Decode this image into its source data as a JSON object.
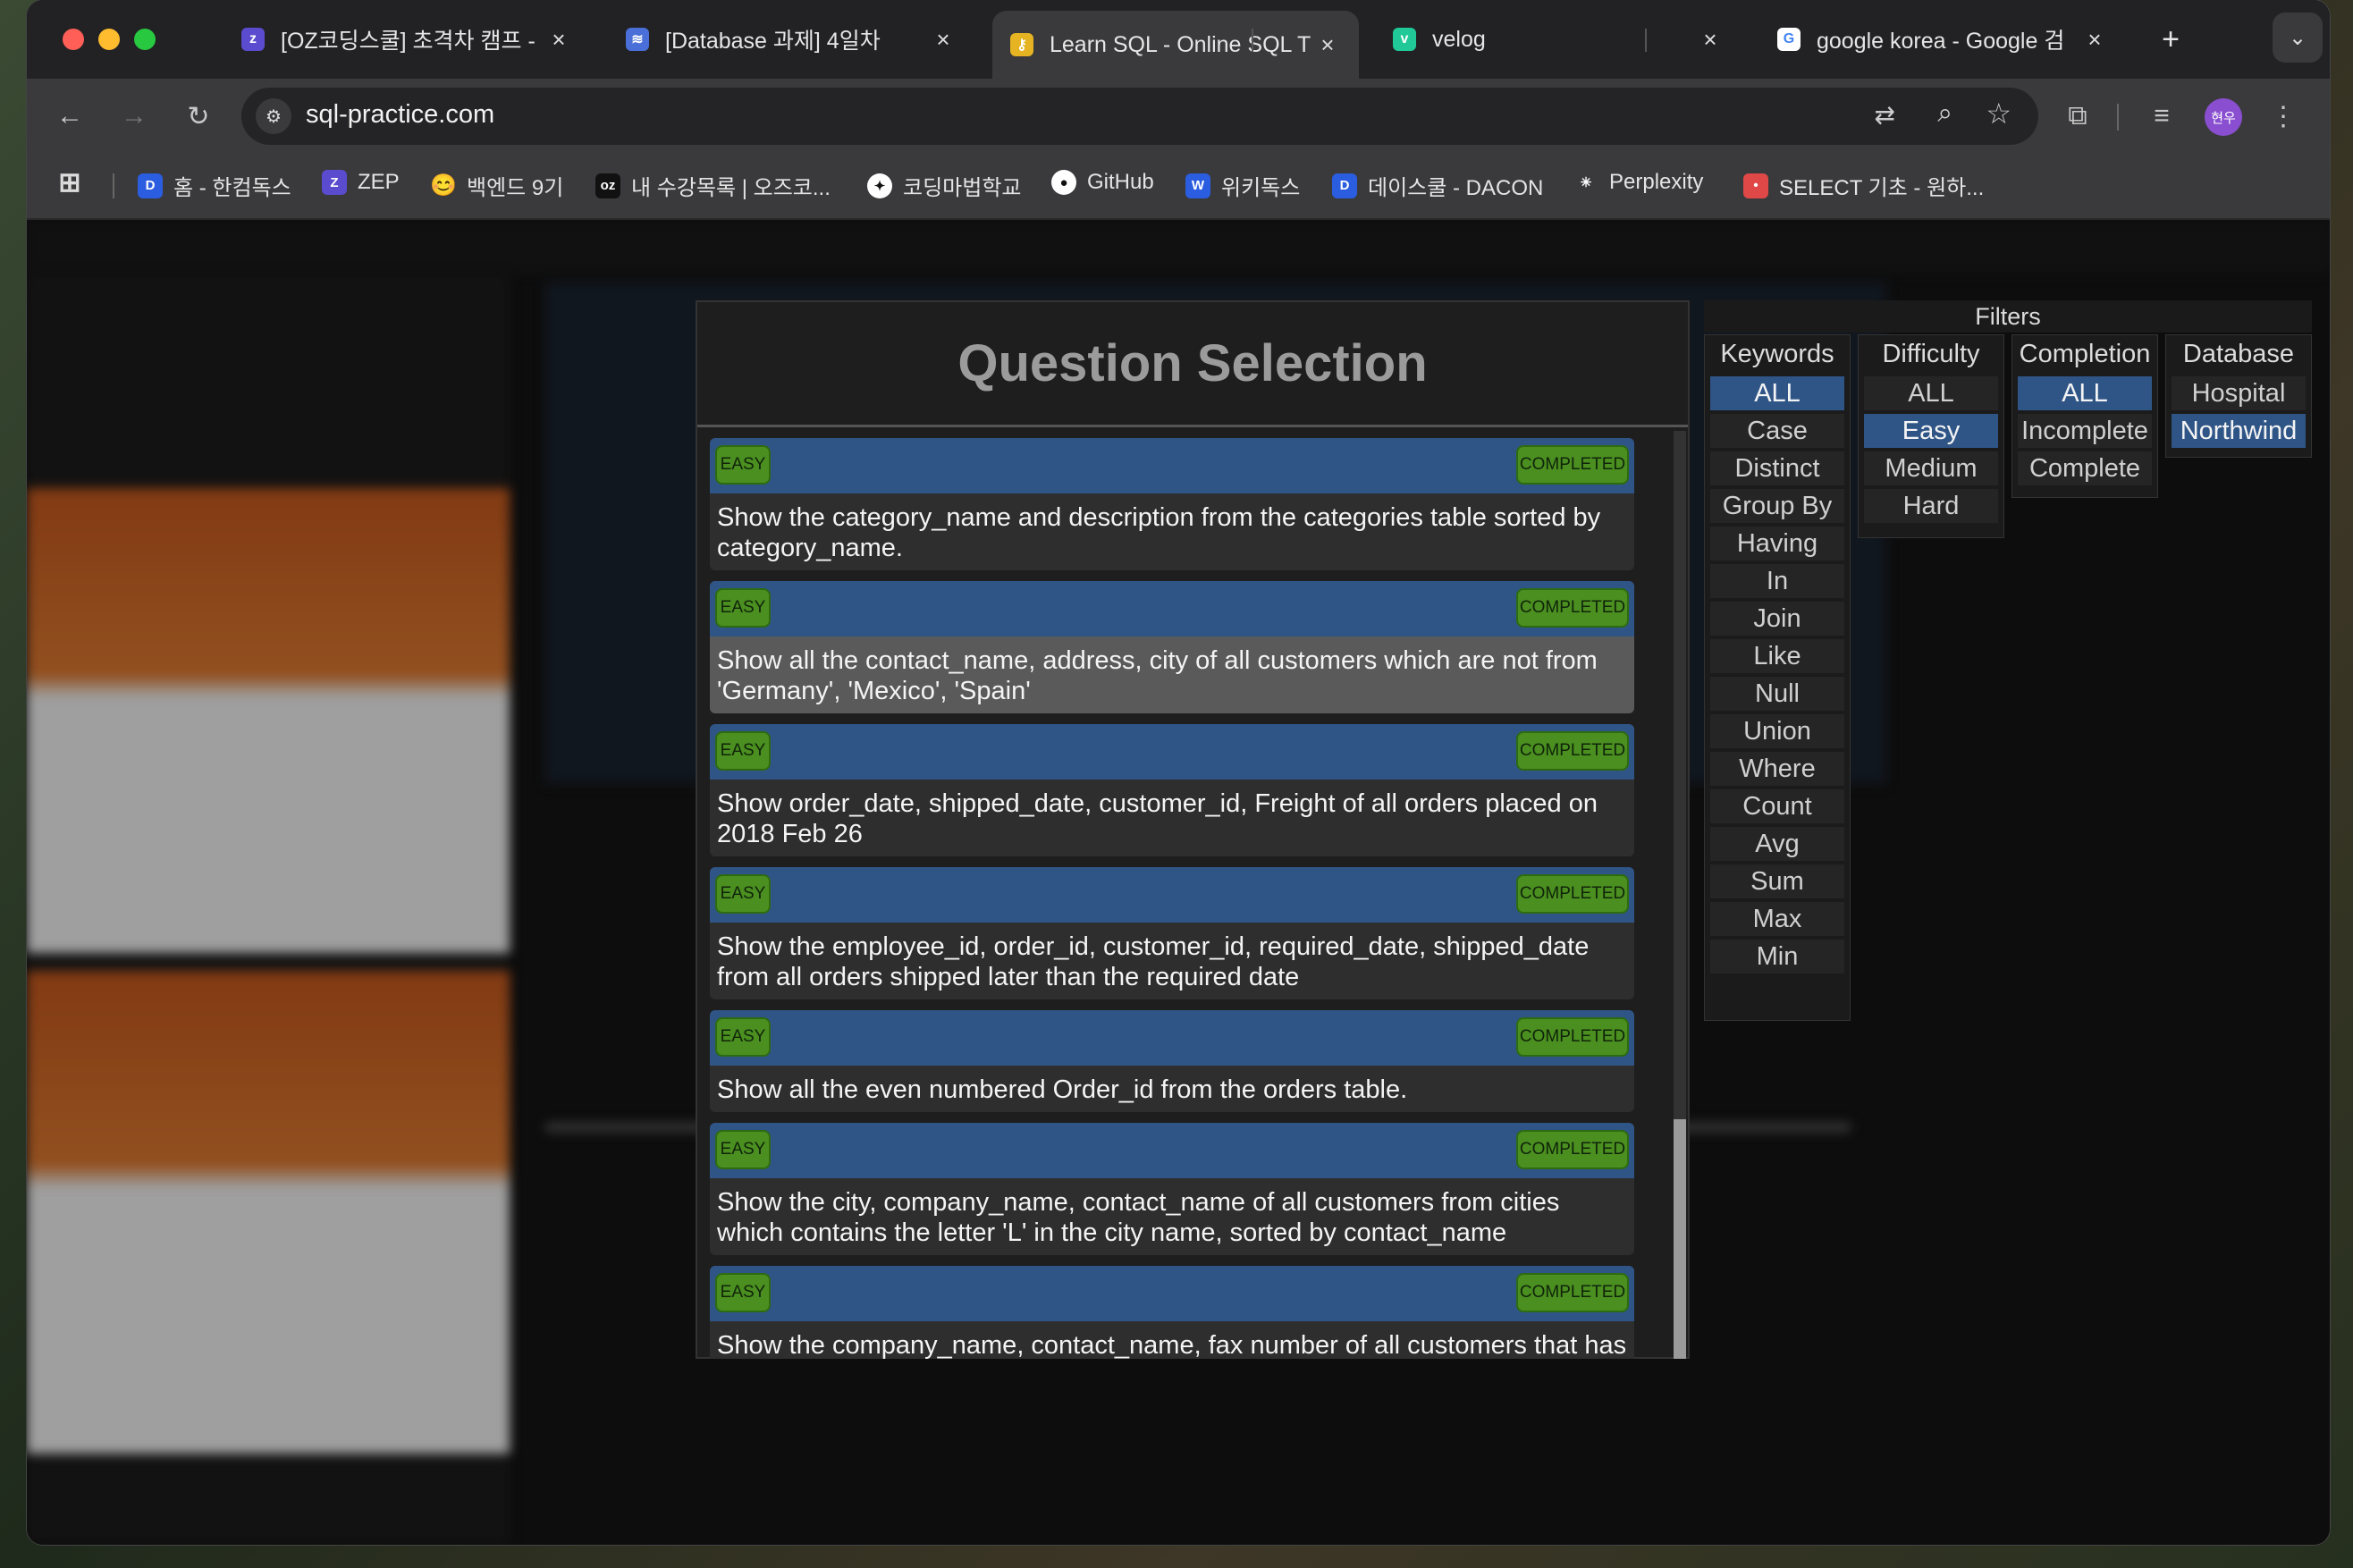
{
  "browser": {
    "tabs": [
      {
        "title": "[OZ코딩스쿨] 초격차 캠프 - ",
        "icon": "oz-logo-icon",
        "icon_color": "#5b4ccf",
        "active": false
      },
      {
        "title": "[Database 과제] 4일차",
        "icon": "database-icon",
        "icon_color": "#4a6fd8",
        "active": false
      },
      {
        "title": "Learn SQL - Online SQL T",
        "icon": "key-icon",
        "icon_color": "#e6b422",
        "active": true
      },
      {
        "title": "velog",
        "icon": "velog-icon",
        "icon_color": "#20c997",
        "active": false
      },
      {
        "title": "google korea - Google 검",
        "icon": "google-icon",
        "icon_color": "#ffffff",
        "active": false
      }
    ],
    "new_tab": "+",
    "url": "sql-practice.com",
    "profile": "현우",
    "bookmarks": [
      {
        "label": "",
        "icon": "apps-grid-icon"
      },
      {
        "label": "홈 - 한컴독스",
        "icon": "hancom-docs-icon",
        "icon_color": "#2b5de0",
        "glyph": "D"
      },
      {
        "label": "ZEP",
        "icon": "zep-icon",
        "icon_color": "#5b4ccf",
        "glyph": "Z"
      },
      {
        "label": "백엔드 9기",
        "icon": "smile-emoji-icon",
        "glyph": "😊"
      },
      {
        "label": "내 수강목록 | 오즈코...",
        "icon": "oz-icon",
        "icon_color": "#111111",
        "glyph": "oz"
      },
      {
        "label": "코딩마법학교",
        "icon": "wand-icon",
        "icon_color": "#ffffff",
        "glyph": "✦"
      },
      {
        "label": "GitHub",
        "icon": "github-icon",
        "icon_color": "#ffffff",
        "glyph": "●"
      },
      {
        "label": "위키독스",
        "icon": "wikidocs-icon",
        "icon_color": "#2b5de0",
        "glyph": "W"
      },
      {
        "label": "데이스쿨 - DACON",
        "icon": "dacon-icon",
        "icon_color": "#2b5de0",
        "glyph": "D"
      },
      {
        "label": "Perplexity",
        "icon": "perplexity-icon",
        "icon_color": "#3a3a3c",
        "glyph": "✳"
      },
      {
        "label": "SELECT 기초 - 원하...",
        "icon": "select-basics-icon",
        "icon_color": "#e04848",
        "glyph": "•"
      }
    ]
  },
  "modal": {
    "title": "Question Selection",
    "questions": [
      {
        "difficulty": "EASY",
        "status": "COMPLETED",
        "text": "Show the category_name and description from the categories table sorted by category_name."
      },
      {
        "difficulty": "EASY",
        "status": "COMPLETED",
        "text": "Show all the contact_name, address, city of all customers which are not from 'Germany', 'Mexico', 'Spain'"
      },
      {
        "difficulty": "EASY",
        "status": "COMPLETED",
        "text": "Show order_date, shipped_date, customer_id, Freight of all orders placed on 2018 Feb 26"
      },
      {
        "difficulty": "EASY",
        "status": "COMPLETED",
        "text": "Show the employee_id, order_id, customer_id, required_date, shipped_date from all orders shipped later than the required date"
      },
      {
        "difficulty": "EASY",
        "status": "COMPLETED",
        "text": "Show all the even numbered Order_id from the orders table."
      },
      {
        "difficulty": "EASY",
        "status": "COMPLETED",
        "text": "Show the city, company_name, contact_name of all customers from cities which contains the letter 'L' in the city name, sorted by contact_name"
      },
      {
        "difficulty": "EASY",
        "status": "COMPLETED",
        "text": "Show the company_name, contact_name, fax number of all customers that has"
      }
    ]
  },
  "filters": {
    "title": "Filters",
    "columns": [
      {
        "header": "Keywords",
        "options": [
          "ALL",
          "Case",
          "Distinct",
          "Group By",
          "Having",
          "In",
          "Join",
          "Like",
          "Null",
          "Union",
          "Where",
          "Count",
          "Avg",
          "Sum",
          "Max",
          "Min"
        ],
        "selected": "ALL"
      },
      {
        "header": "Difficulty",
        "options": [
          "ALL",
          "Easy",
          "Medium",
          "Hard"
        ],
        "selected": "Easy"
      },
      {
        "header": "Completion",
        "options": [
          "ALL",
          "Incomplete",
          "Complete"
        ],
        "selected": "ALL"
      },
      {
        "header": "Database",
        "options": [
          "Hospital",
          "Northwind"
        ],
        "selected": "Northwind"
      }
    ]
  },
  "colors": {
    "question_header": "#2f5587",
    "badge_green": "#4a8f20",
    "selected_filter": "#2f5587"
  }
}
